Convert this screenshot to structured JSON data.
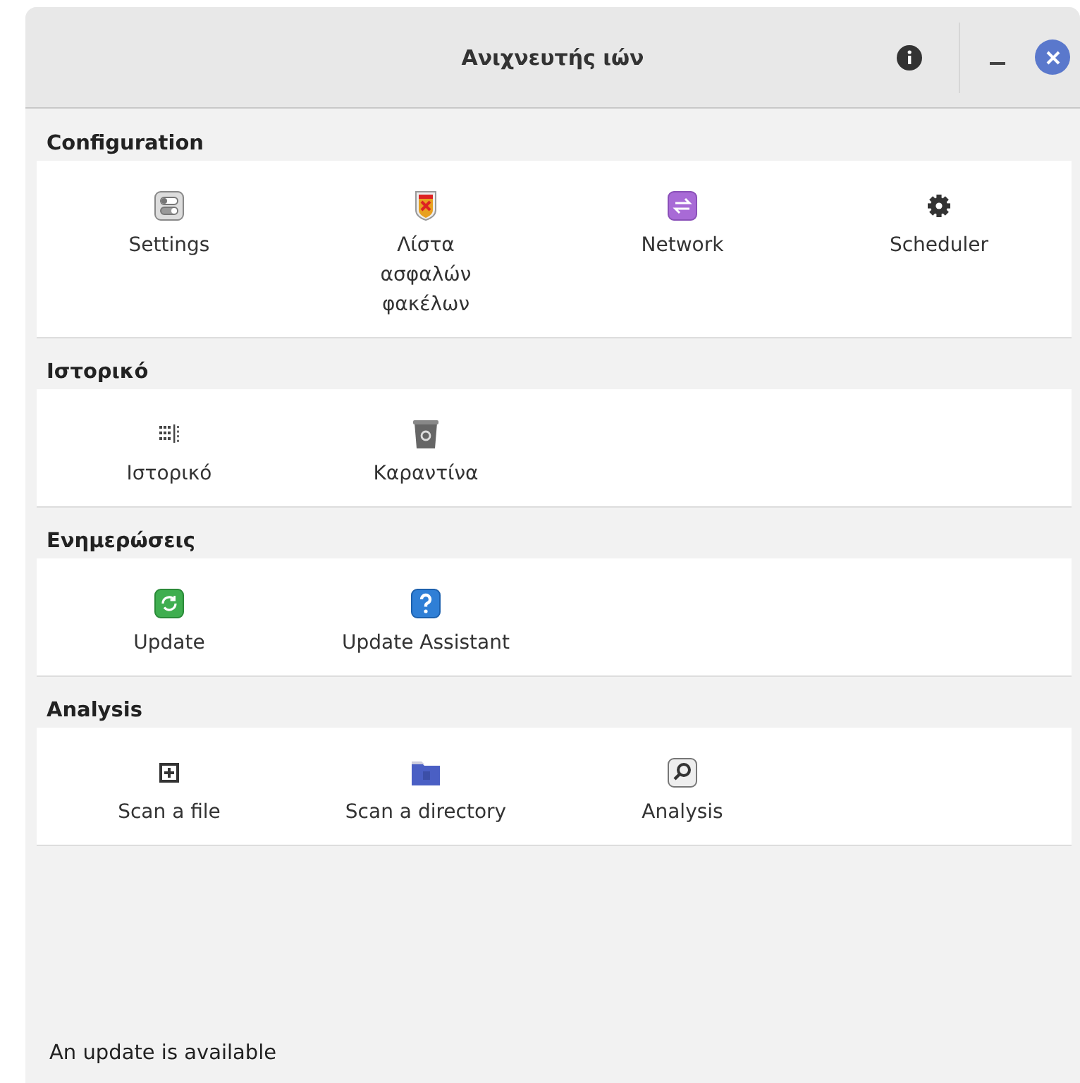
{
  "window": {
    "title": "Ανιχνευτής ιών"
  },
  "sections": [
    {
      "title": "Configuration",
      "items": [
        {
          "label": "Settings"
        },
        {
          "label": "Λίστα ασφαλών φακέλων"
        },
        {
          "label": "Network"
        },
        {
          "label": "Scheduler"
        }
      ]
    },
    {
      "title": "Ιστορικό",
      "items": [
        {
          "label": "Ιστορικό"
        },
        {
          "label": "Καραντίνα"
        }
      ]
    },
    {
      "title": "Ενημερώσεις",
      "items": [
        {
          "label": "Update"
        },
        {
          "label": "Update Assistant"
        }
      ]
    },
    {
      "title": "Analysis",
      "items": [
        {
          "label": "Scan a file"
        },
        {
          "label": "Scan a directory"
        },
        {
          "label": "Analysis"
        }
      ]
    }
  ],
  "status_bar": {
    "text": "An update is available"
  }
}
